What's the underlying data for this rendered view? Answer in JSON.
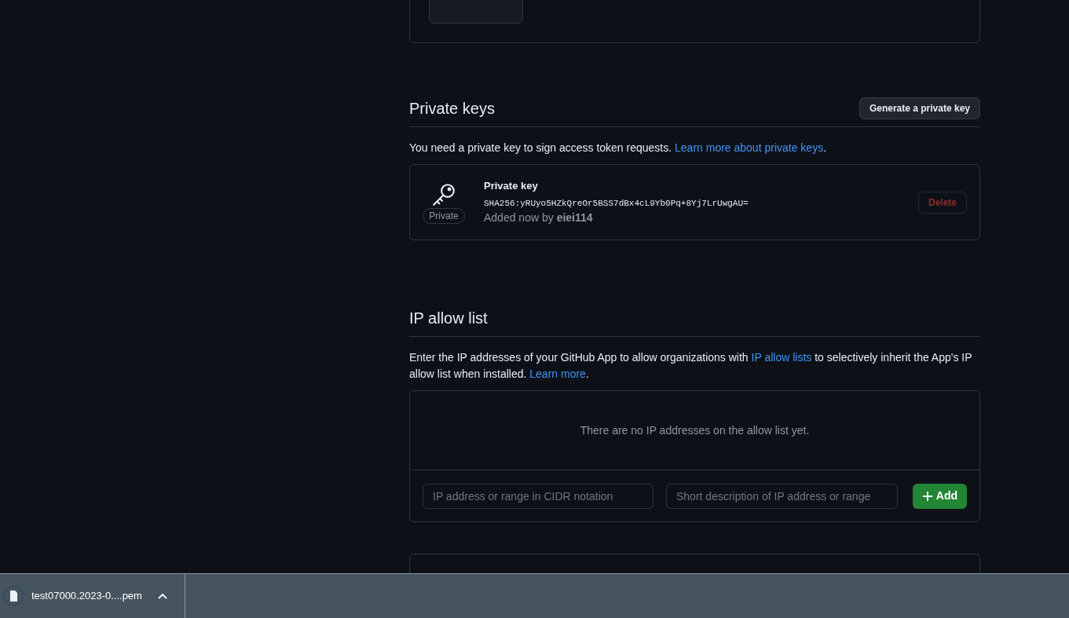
{
  "private_keys": {
    "title": "Private keys",
    "generate_button": "Generate a private key",
    "description": {
      "text": "You need a private key to sign access token requests. ",
      "link": "Learn more about private keys",
      "after": "."
    },
    "keys": [
      {
        "badge": "Private",
        "name": "Private key",
        "fingerprint": "SHA256:yRUyo5HZkQreOr5BSS7dBx4cL9Yb0Pq+8Yj7LrUwgAU=",
        "added": "Added now by ",
        "user": "eiei114",
        "delete_button": "Delete"
      }
    ]
  },
  "ip_allow_list": {
    "title": "IP allow list",
    "description": {
      "text": "Enter the IP addresses of your GitHub App to allow organizations with ",
      "link": "IP allow lists",
      "middle": " to selectively inherit the App's IP allow list when installed. ",
      "link2": "Learn more",
      "after": "."
    },
    "empty_message": "There are no IP addresses on the allow list yet.",
    "address_placeholder": "IP address or range in CIDR notation",
    "description_placeholder": "Short description of IP address or range",
    "add_button": "Add"
  },
  "download_bar": {
    "items": [
      {
        "filename": "test07000.2023-0....pem"
      }
    ]
  }
}
